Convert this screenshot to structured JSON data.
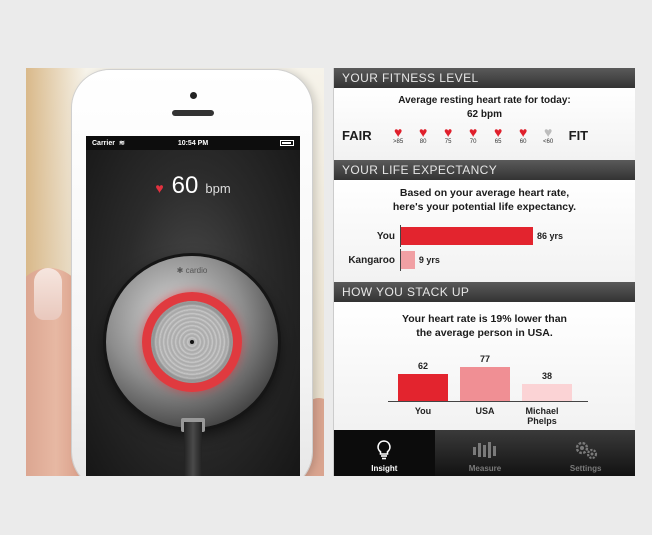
{
  "phone": {
    "status": {
      "carrier": "Carrier",
      "time": "10:54 PM"
    },
    "bpm": {
      "value": "60",
      "unit": "bpm"
    },
    "brand": "cardio"
  },
  "app": {
    "fitness": {
      "header": "YOUR FITNESS LEVEL",
      "line1": "Average resting heart rate for today:",
      "line2": "62 bpm",
      "left_label": "FAIR",
      "right_label": "FIT",
      "hearts": [
        {
          "label": ">85",
          "color": "red"
        },
        {
          "label": "80",
          "color": "red"
        },
        {
          "label": "75",
          "color": "red"
        },
        {
          "label": "70",
          "color": "red"
        },
        {
          "label": "65",
          "color": "red"
        },
        {
          "label": "60",
          "color": "red"
        },
        {
          "label": "<60",
          "color": "grey"
        }
      ]
    },
    "life": {
      "header": "YOUR LIFE EXPECTANCY",
      "line1": "Based on your average heart rate,",
      "line2": "here's your potential life expectancy.",
      "bars": [
        {
          "label": "You",
          "value": 86,
          "text": "86 yrs",
          "color": "#e3242e"
        },
        {
          "label": "Kangaroo",
          "value": 9,
          "text": "9 yrs",
          "color": "#f1a0a4"
        }
      ]
    },
    "stack": {
      "header": "HOW YOU STACK UP",
      "line1": "Your heart rate is 19% lower than",
      "line2": "the average person in USA.",
      "bars": [
        {
          "label": "You",
          "value": 62,
          "text": "62",
          "color": "#e3242e"
        },
        {
          "label": "USA",
          "value": 77,
          "text": "77",
          "color": "#f08f94"
        },
        {
          "label": "Michael Phelps",
          "value": 38,
          "text": "38",
          "color": "#fbd3d5"
        }
      ]
    },
    "tabs": [
      {
        "label": "Insight",
        "icon": "lightbulb-icon",
        "active": true
      },
      {
        "label": "Measure",
        "icon": "heartbeat-icon",
        "active": false
      },
      {
        "label": "Settings",
        "icon": "gear-icon",
        "active": false
      }
    ]
  }
}
